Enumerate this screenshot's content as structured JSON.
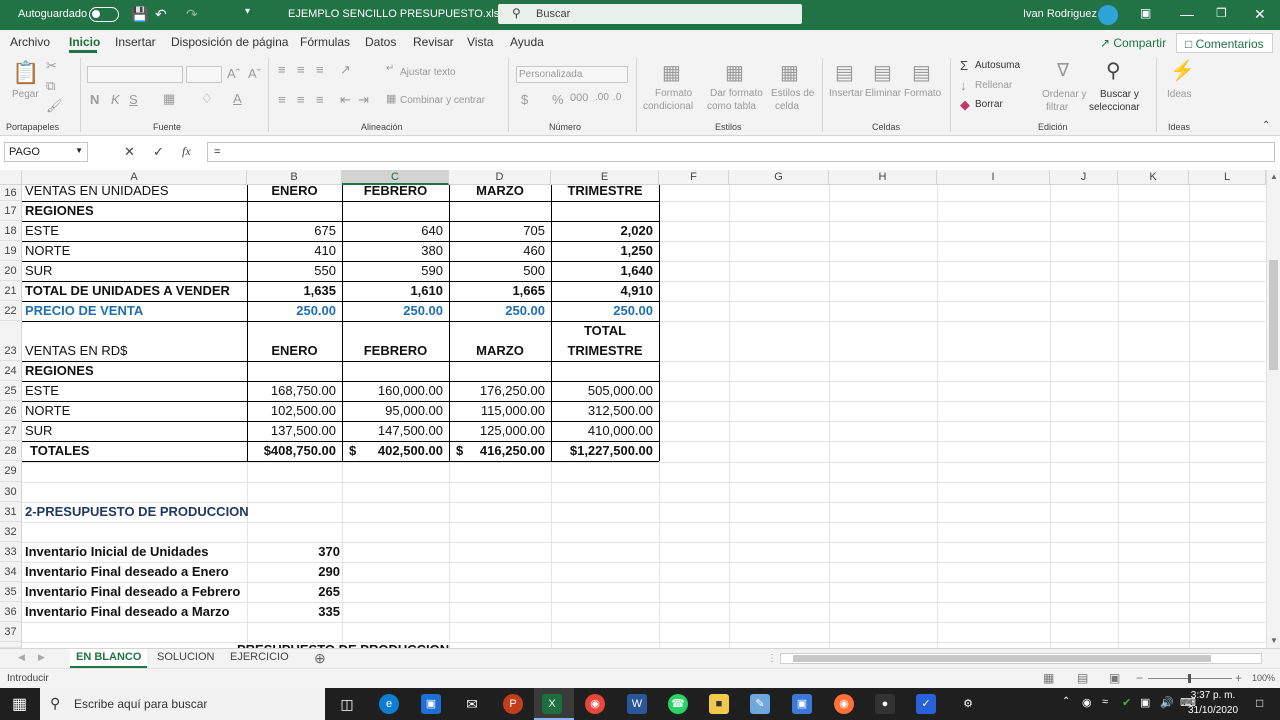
{
  "titlebar": {
    "autosave_label": "Autoguardado",
    "filename": "EJEMPLO SENCILLO PRESUPUESTO.xlsx",
    "search_placeholder": "Buscar",
    "user": "Ivan Rodriguez"
  },
  "menu": {
    "tabs": [
      "Archivo",
      "Inicio",
      "Insertar",
      "Disposición de página",
      "Fórmulas",
      "Datos",
      "Revisar",
      "Vista",
      "Ayuda"
    ],
    "share": "Compartir",
    "comments": "Comentarios"
  },
  "ribbon": {
    "groups": {
      "clipboard": "Portapapeles",
      "font": "Fuente",
      "alignment": "Alineación",
      "number": "Número",
      "styles": "Estilos",
      "cells": "Celdas",
      "editing": "Edición",
      "ideas": "Ideas"
    },
    "paste": "Pegar",
    "wrap_text": "Ajustar texto",
    "merge_center": "Combinar y centrar",
    "number_format": "Personalizada",
    "cond_format_1": "Formato",
    "cond_format_2": "condicional",
    "format_table_1": "Dar formato",
    "format_table_2": "como tabla",
    "cell_styles_1": "Estilos de",
    "cell_styles_2": "celda",
    "insert": "Insertar",
    "delete": "Eliminar",
    "format": "Formato",
    "autosum": "Autosuma",
    "fill": "Rellenar",
    "clear": "Borrar",
    "sort_filter_1": "Ordenar y",
    "sort_filter_2": "filtrar",
    "find_select_1": "Buscar y",
    "find_select_2": "seleccionar",
    "ideas": "Ideas"
  },
  "formula_bar": {
    "name_box": "PAGO",
    "content": "="
  },
  "columns": [
    "A",
    "B",
    "C",
    "D",
    "E",
    "F",
    "G",
    "H",
    "I",
    "J",
    "K",
    "L"
  ],
  "rows": {
    "r16": {
      "num": "16",
      "a": "VENTAS EN UNIDADES",
      "b": "ENERO",
      "c": "FEBRERO",
      "d": "MARZO",
      "e": "TRIMESTRE"
    },
    "r17": {
      "num": "17",
      "a": "REGIONES"
    },
    "r18": {
      "num": "18",
      "a": "ESTE",
      "b": "675",
      "c": "640",
      "d": "705",
      "e": "2,020"
    },
    "r19": {
      "num": "19",
      "a": "NORTE",
      "b": "410",
      "c": "380",
      "d": "460",
      "e": "1,250"
    },
    "r20": {
      "num": "20",
      "a": "SUR",
      "b": "550",
      "c": "590",
      "d": "500",
      "e": "1,640"
    },
    "r21": {
      "num": "21",
      "a": "TOTAL DE UNIDADES A VENDER",
      "b": "1,635",
      "c": "1,610",
      "d": "1,665",
      "e": "4,910"
    },
    "r22": {
      "num": "22",
      "a": "PRECIO DE VENTA",
      "b": "250.00",
      "c": "250.00",
      "d": "250.00",
      "e": "250.00"
    },
    "r23": {
      "num": "23",
      "a": "VENTAS EN RD$",
      "b": "ENERO",
      "c": "FEBRERO",
      "d": "MARZO",
      "e1": "TOTAL",
      "e2": "TRIMESTRE"
    },
    "r24": {
      "num": "24",
      "a": "REGIONES"
    },
    "r25": {
      "num": "25",
      "a": "ESTE",
      "b": "168,750.00",
      "c": "160,000.00",
      "d": "176,250.00",
      "e": "505,000.00"
    },
    "r26": {
      "num": "26",
      "a": "NORTE",
      "b": "102,500.00",
      "c": "95,000.00",
      "d": "115,000.00",
      "e": "312,500.00"
    },
    "r27": {
      "num": "27",
      "a": "SUR",
      "b": "137,500.00",
      "c": "147,500.00",
      "d": "125,000.00",
      "e": "410,000.00"
    },
    "r28": {
      "num": "28",
      "a": "TOTALES",
      "b": "$408,750.00",
      "c_sym": "$",
      "c": "402,500.00",
      "d_sym": "$",
      "d": "416,250.00",
      "e": "$1,227,500.00"
    },
    "r29": {
      "num": "29"
    },
    "r30": {
      "num": "30"
    },
    "r31": {
      "num": "31",
      "a": "2-PRESUPUESTO DE PRODUCCION"
    },
    "r32": {
      "num": "32"
    },
    "r33": {
      "num": "33",
      "a": "Inventario Inicial de Unidades",
      "b": "370"
    },
    "r34": {
      "num": "34",
      "a": "Inventario Final deseado a Enero",
      "b": "290"
    },
    "r35": {
      "num": "35",
      "a": "Inventario Final deseado a Febrero",
      "b": "265"
    },
    "r36": {
      "num": "36",
      "a": "Inventario Final deseado a Marzo",
      "b": "335"
    },
    "r37": {
      "num": "37"
    },
    "r38_partial": "PRESUPUESTO DE PRODUCCION"
  },
  "sheets": [
    "EN BLANCO",
    "SOLUCION",
    "EJERCICIO"
  ],
  "statusbar": {
    "mode": "Introducir",
    "zoom": "100%"
  },
  "taskbar": {
    "search_placeholder": "Escribe aquí para buscar",
    "time": "3:37 p. m.",
    "date": "31/10/2020"
  }
}
